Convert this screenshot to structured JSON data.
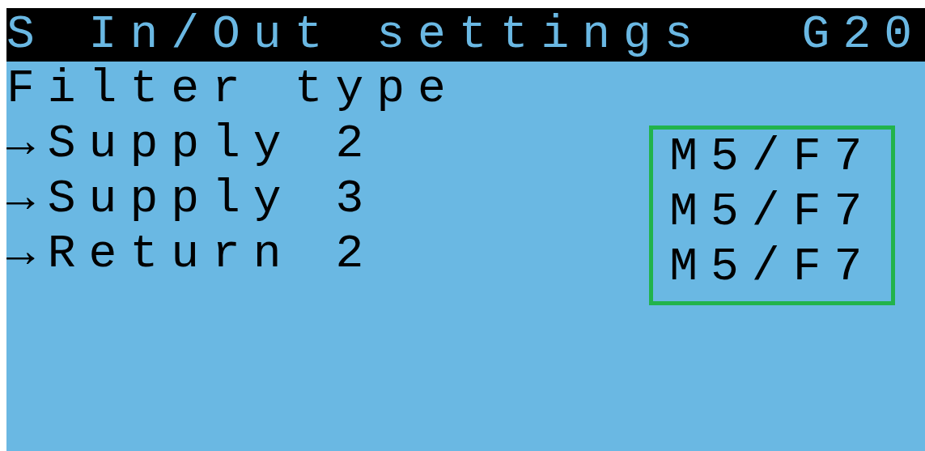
{
  "title": "S In/Out settings",
  "code": "G20",
  "heading": "Filter type",
  "rows": [
    {
      "label": "→Supply 2",
      "value": "M5/F7"
    },
    {
      "label": "→Supply 3",
      "value": "M5/F7"
    },
    {
      "label": "→Return 2",
      "value": "M5/F7"
    }
  ],
  "values_highlighted": true
}
